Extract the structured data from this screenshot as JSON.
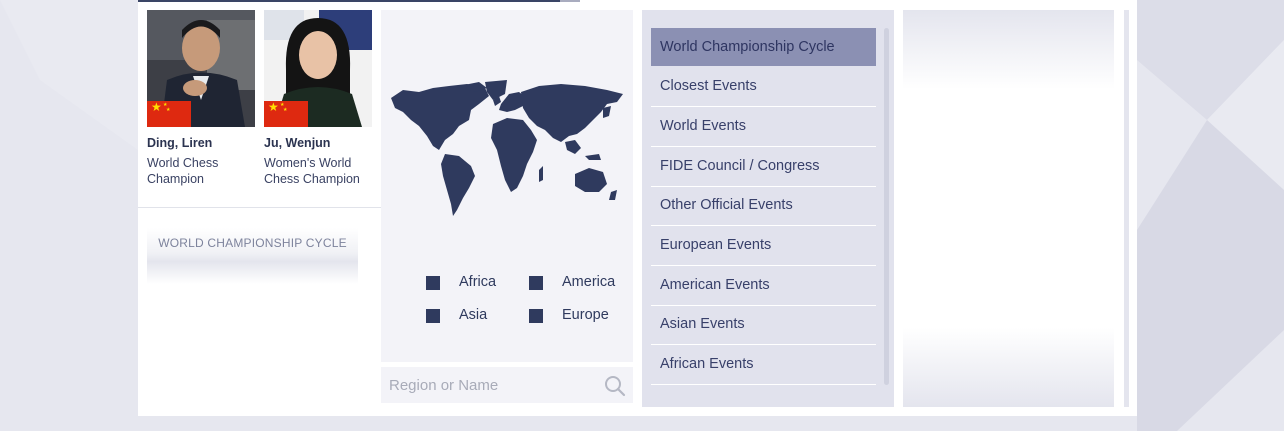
{
  "champions": [
    {
      "name": "Ding, Liren",
      "title": "World Chess Champion",
      "flag": "china-flag"
    },
    {
      "name": "Ju, Wenjun",
      "title": "Women's World Chess Champion",
      "flag": "china-flag"
    }
  ],
  "world_championship_button": "WORLD CHAMPIONSHIP CYCLE",
  "map": {
    "regions": [
      "Africa",
      "America",
      "Asia",
      "Europe"
    ]
  },
  "search": {
    "placeholder": "Region or Name",
    "icon": "search-icon"
  },
  "categories": [
    {
      "label": "World Championship Cycle",
      "active": true
    },
    {
      "label": "Closest Events",
      "active": false
    },
    {
      "label": "World Events",
      "active": false
    },
    {
      "label": "FIDE Council / Congress",
      "active": false
    },
    {
      "label": "Other Official Events",
      "active": false
    },
    {
      "label": "European Events",
      "active": false
    },
    {
      "label": "American Events",
      "active": false
    },
    {
      "label": "Asian Events",
      "active": false
    },
    {
      "label": "African Events",
      "active": false
    }
  ],
  "colors": {
    "accent": "#2f3a5e",
    "active_category": "#8b90b3",
    "category_bg": "#e1e2ed",
    "flag_red": "#de2910",
    "flag_star": "#ffde00"
  }
}
